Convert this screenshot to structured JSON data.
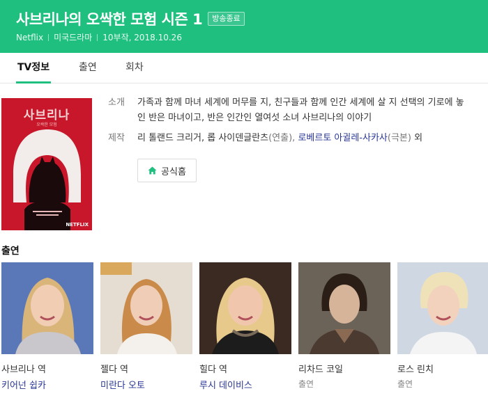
{
  "header": {
    "title": "사브리나의 오싹한 모험 시즌 1",
    "badge": "방송종료",
    "meta": [
      "Netflix",
      "미국드라마",
      "10부작, 2018.10.26"
    ]
  },
  "tabs": [
    {
      "label": "TV정보",
      "active": true
    },
    {
      "label": "출연",
      "active": false
    },
    {
      "label": "회차",
      "active": false
    }
  ],
  "poster": {
    "title": "사브리나",
    "subtitle": "오싹한 모험",
    "logo": "NETFLIX",
    "colors": {
      "background": "#c8162a",
      "hair": "#f2ecea",
      "figure": "#1a0a0c"
    }
  },
  "info": {
    "synopsis_label": "소개",
    "synopsis": "가족과 함께 마녀 세계에 머무를 지, 친구들과 함께 인간 세계에 살 지 선택의 기로에 놓인 반은 마녀이고, 반은 인간인 열여섯 소녀 사브리나의 이야기",
    "production_label": "제작",
    "production_director": "리 톨랜드 크리거, 롭 사이덴글란츠",
    "production_director_role": "(연출),",
    "production_writer": "로베르토 아귈레-사카사",
    "production_writer_role": "(극본)",
    "production_more": "외"
  },
  "home_button": {
    "label": "공식홈",
    "icon": "home-icon"
  },
  "cast": {
    "heading": "출연",
    "members": [
      {
        "role": "사브리나 역",
        "name": "키어넌 쉽카",
        "linked": true,
        "photo_bg": "#5a78b8",
        "hair": "#d9b57a",
        "skin": "#f1cdb3"
      },
      {
        "role": "젤다 역",
        "name": "미란다 오토",
        "linked": true,
        "photo_bg": "#e6ddd2",
        "hair": "#c98a4a",
        "skin": "#f0cdb6"
      },
      {
        "role": "힐다 역",
        "name": "루시 데이비스",
        "linked": true,
        "photo_bg": "#3a2a22",
        "hair": "#e7c98b",
        "skin": "#f0c7ac"
      },
      {
        "role": "리차드 코일",
        "name": "출연",
        "linked": false,
        "photo_bg": "#6b6258",
        "hair": "#2a1e17",
        "skin": "#d6b49a"
      },
      {
        "role": "로스 린치",
        "name": "출연",
        "linked": false,
        "photo_bg": "#cfd8e2",
        "hair": "#efe2b8",
        "skin": "#f2d2bd"
      }
    ]
  },
  "colors": {
    "accent": "#1fbf7f",
    "link": "#283593"
  }
}
